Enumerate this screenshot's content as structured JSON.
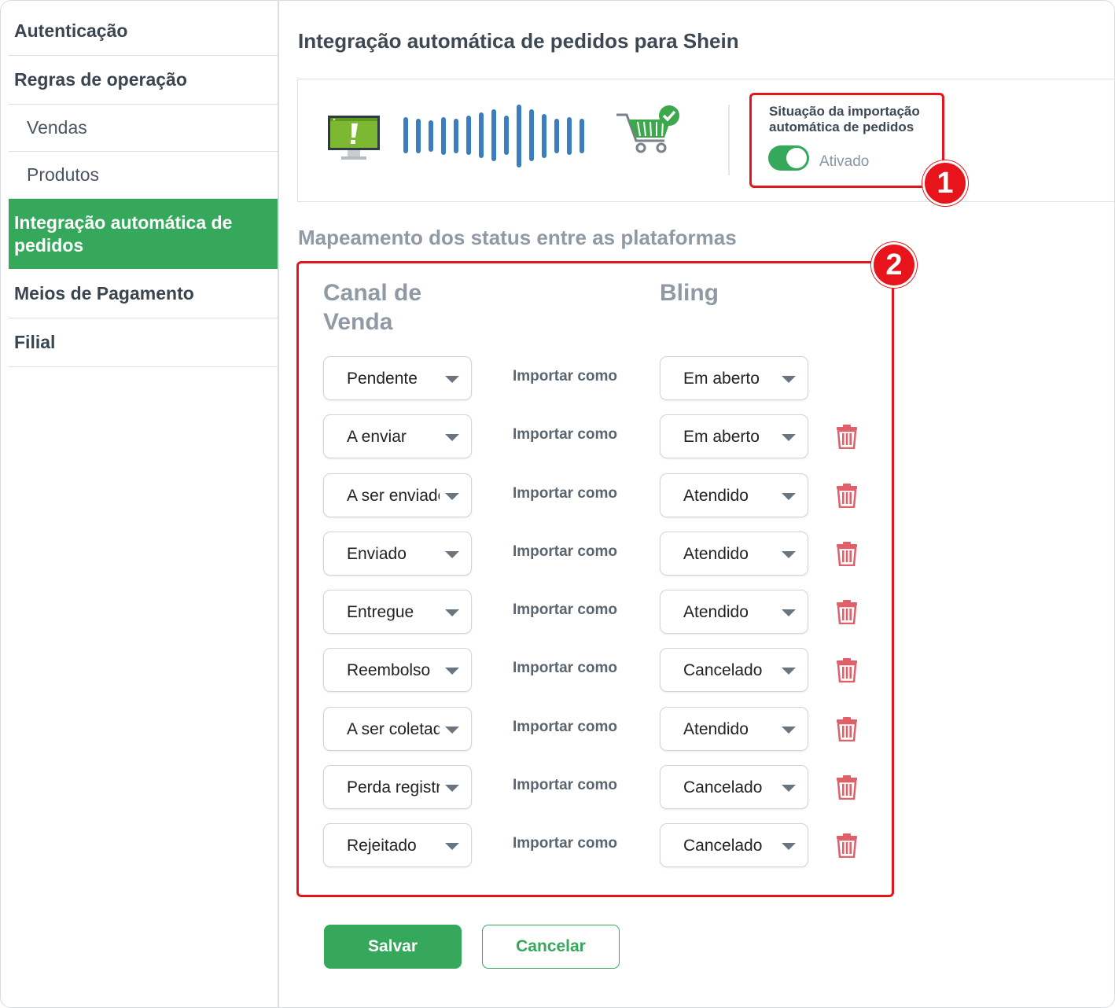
{
  "sidebar": {
    "items": [
      {
        "label": "Autenticação",
        "active": false,
        "sub": false
      },
      {
        "label": "Regras de operação",
        "active": false,
        "sub": false
      },
      {
        "label": "Vendas",
        "active": false,
        "sub": true
      },
      {
        "label": "Produtos",
        "active": false,
        "sub": true
      },
      {
        "label": "Integração automática de pedidos",
        "active": true,
        "sub": false
      },
      {
        "label": "Meios de Pagamento",
        "active": false,
        "sub": false
      },
      {
        "label": "Filial",
        "active": false,
        "sub": false
      }
    ]
  },
  "header": {
    "title": "Integração automática de pedidos para Shein"
  },
  "import_status": {
    "label": "Situação da importação automática de pedidos",
    "state_label": "Ativado",
    "enabled": true
  },
  "mapping": {
    "title": "Mapeamento dos status entre as plataformas",
    "col_channel": "Canal de Venda",
    "col_bling": "Bling",
    "import_label": "Importar como",
    "rows": [
      {
        "channel": "Pendente",
        "bling": "Em aberto",
        "deletable": false
      },
      {
        "channel": "A enviar",
        "bling": "Em aberto",
        "deletable": true
      },
      {
        "channel": "A ser enviado",
        "bling": "Atendido",
        "deletable": true
      },
      {
        "channel": "Enviado",
        "bling": "Atendido",
        "deletable": true
      },
      {
        "channel": "Entregue",
        "bling": "Atendido",
        "deletable": true
      },
      {
        "channel": "Reembolso",
        "bling": "Cancelado",
        "deletable": true
      },
      {
        "channel": "A ser coletado",
        "bling": "Atendido",
        "deletable": true
      },
      {
        "channel": "Perda registrada",
        "bling": "Cancelado",
        "deletable": true
      },
      {
        "channel": "Rejeitado",
        "bling": "Cancelado",
        "deletable": true
      }
    ]
  },
  "annotations": {
    "badge_1": "1",
    "badge_2": "2"
  },
  "actions": {
    "save_label": "Salvar",
    "cancel_label": "Cancelar"
  },
  "colors": {
    "accent": "#35a85c",
    "callout": "#e8141c",
    "trash": "#e0606a"
  }
}
